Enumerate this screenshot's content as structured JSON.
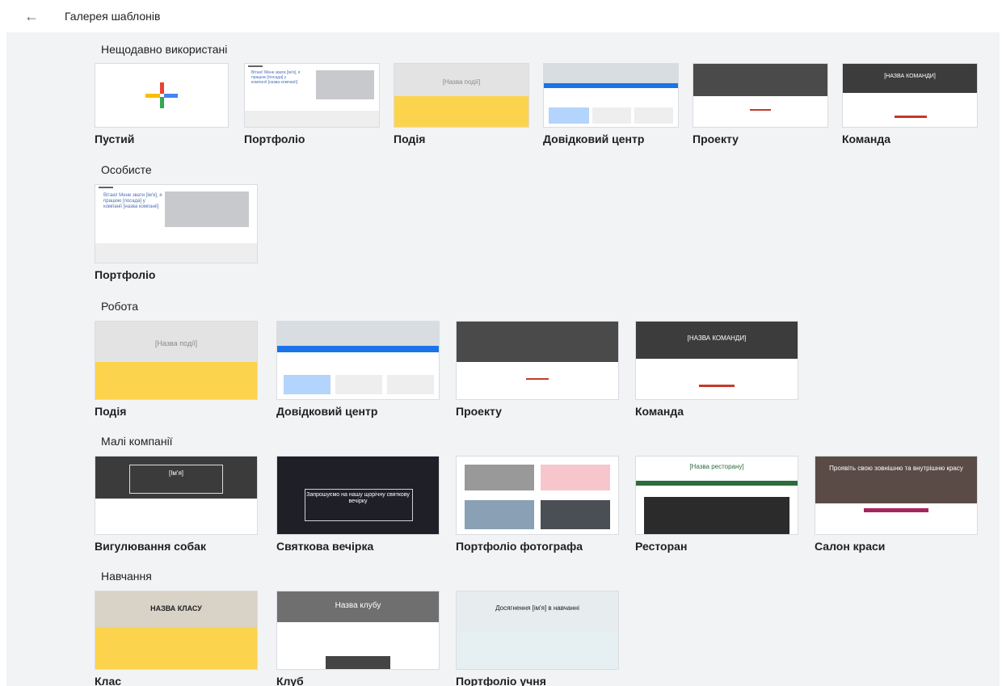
{
  "header": {
    "back_icon": "arrow-left-icon",
    "title": "Галерея шаблонів"
  },
  "sections": {
    "recent": {
      "title": "Нещодавно використані",
      "items": [
        {
          "label": "Пустий"
        },
        {
          "label": "Портфоліо"
        },
        {
          "label": "Подія"
        },
        {
          "label": "Довідковий центр"
        },
        {
          "label": "Проекту"
        },
        {
          "label": "Команда"
        }
      ]
    },
    "personal": {
      "title": "Особисте",
      "items": [
        {
          "label": "Портфоліо"
        }
      ]
    },
    "work": {
      "title": "Робота",
      "items": [
        {
          "label": "Подія"
        },
        {
          "label": "Довідковий центр"
        },
        {
          "label": "Проекту"
        },
        {
          "label": "Команда"
        }
      ]
    },
    "small_business": {
      "title": "Малі компанії",
      "items": [
        {
          "label": "Вигулювання собак"
        },
        {
          "label": "Святкова вечірка"
        },
        {
          "label": "Портфоліо фотографа"
        },
        {
          "label": "Ресторан"
        },
        {
          "label": "Салон краси"
        }
      ]
    },
    "education": {
      "title": "Навчання",
      "items": [
        {
          "label": "Клас"
        },
        {
          "label": "Клуб"
        },
        {
          "label": "Портфоліо учня"
        }
      ]
    }
  },
  "thumb_text": {
    "portfolio": "Вітаю! Мене звати [ім'я], я працюю [посада] у компанії [назва компанії]",
    "event": "[Назва події]",
    "team": "[НАЗВА КОМАНДИ]",
    "dog": "[Ім'я]",
    "party": "Запрошуємо на нашу щорічну святкову вечірку",
    "restaurant": "[Назва ресторану]",
    "beauty": "Проявіть свою зовнішню та внутрішню красу",
    "class": "НАЗВА КЛАСУ",
    "club": "Назва клубу",
    "student": "Досягнення [ім'я] в навчанні"
  },
  "colors": {
    "background": "#f1f3f4",
    "accent_blue": "#1a73e8",
    "accent_yellow": "#fcd34d",
    "accent_red": "#c53929"
  }
}
